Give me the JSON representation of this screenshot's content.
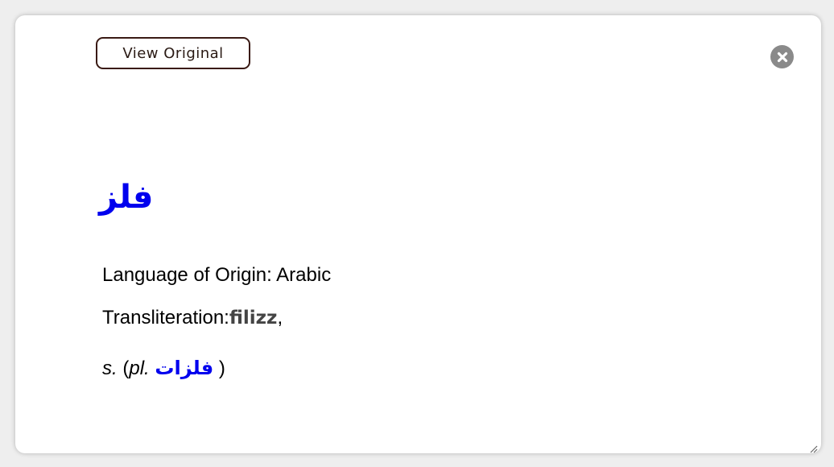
{
  "dialog": {
    "view_original_label": "View Original",
    "close_icon": "close-icon",
    "headword": "فلز",
    "origin_label": "Language of Origin:",
    "origin_value": "Arabic",
    "translit_label": "Transliteration:",
    "translit_value": "filizz",
    "translit_suffix": ",",
    "pos": "s.",
    "plural_open": "(",
    "plural_label": "pl.",
    "plural_value": "فلزات",
    "plural_close": ")"
  },
  "colors": {
    "link": "#0000ee",
    "button_border": "#3a1a14",
    "close_bg": "#8a8a8a"
  }
}
